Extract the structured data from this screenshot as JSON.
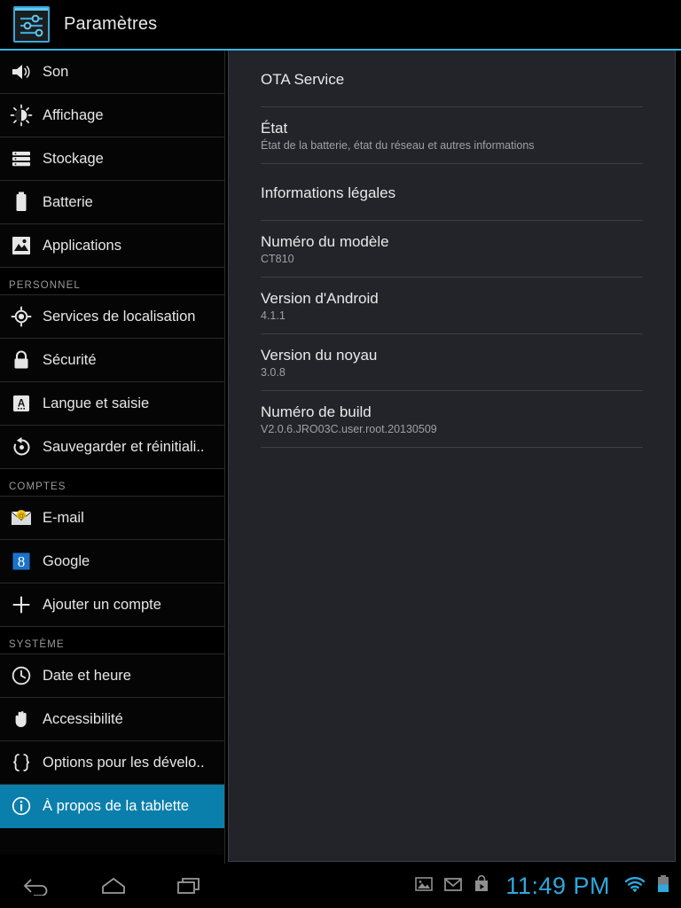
{
  "header": {
    "title": "Paramètres",
    "icon": "settings-sliders-icon",
    "accent_color": "#33b5e5"
  },
  "sidebar": {
    "selected_color": "#0b7fab",
    "entries": [
      {
        "kind": "item",
        "label": "Son",
        "icon": "volume-icon"
      },
      {
        "kind": "item",
        "label": "Affichage",
        "icon": "brightness-icon"
      },
      {
        "kind": "item",
        "label": "Stockage",
        "icon": "storage-icon"
      },
      {
        "kind": "item",
        "label": "Batterie",
        "icon": "battery-icon"
      },
      {
        "kind": "item",
        "label": "Applications",
        "icon": "applications-icon"
      },
      {
        "kind": "section",
        "label": "PERSONNEL"
      },
      {
        "kind": "item",
        "label": "Services de localisation",
        "icon": "location-icon"
      },
      {
        "kind": "item",
        "label": "Sécurité",
        "icon": "lock-icon"
      },
      {
        "kind": "item",
        "label": "Langue et saisie",
        "icon": "keyboard-language-icon"
      },
      {
        "kind": "item",
        "label": "Sauvegarder et réinitiali..",
        "icon": "backup-reset-icon"
      },
      {
        "kind": "section",
        "label": "COMPTES"
      },
      {
        "kind": "item",
        "label": "E-mail",
        "icon": "email-icon"
      },
      {
        "kind": "item",
        "label": "Google",
        "icon": "google-icon"
      },
      {
        "kind": "item",
        "label": "Ajouter un compte",
        "icon": "plus-icon"
      },
      {
        "kind": "section",
        "label": "SYSTÈME"
      },
      {
        "kind": "item",
        "label": "Date et heure",
        "icon": "clock-icon"
      },
      {
        "kind": "item",
        "label": "Accessibilité",
        "icon": "hand-icon"
      },
      {
        "kind": "item",
        "label": "Options pour les dévelo..",
        "icon": "braces-icon"
      },
      {
        "kind": "item",
        "label": "À propos de la tablette",
        "icon": "info-icon",
        "selected": true
      }
    ]
  },
  "content": {
    "rows": [
      {
        "title": "OTA Service",
        "subtitle": ""
      },
      {
        "title": "État",
        "subtitle": "État de la batterie, état du réseau et autres informations"
      },
      {
        "title": "Informations légales",
        "subtitle": ""
      },
      {
        "title": "Numéro du modèle",
        "subtitle": "CT810"
      },
      {
        "title": "Version d'Android",
        "subtitle": "4.1.1"
      },
      {
        "title": "Version du noyau",
        "subtitle": "3.0.8"
      },
      {
        "title": "Numéro de build",
        "subtitle": "V2.0.6.JRO03C.user.root.20130509"
      }
    ]
  },
  "systembar": {
    "softkeys": [
      {
        "name": "back-icon",
        "label": "Retour"
      },
      {
        "name": "home-icon",
        "label": "Accueil"
      },
      {
        "name": "recents-icon",
        "label": "Applications récentes"
      }
    ],
    "status_icons": [
      {
        "name": "screenshot-icon"
      },
      {
        "name": "gmail-icon"
      },
      {
        "name": "play-store-icon"
      }
    ],
    "clock": "11:49 PM",
    "clock_color": "#2fa8dd",
    "wifi_icon": "wifi-icon",
    "battery_icon": "battery-status-icon",
    "battery_level_percent": 50
  }
}
